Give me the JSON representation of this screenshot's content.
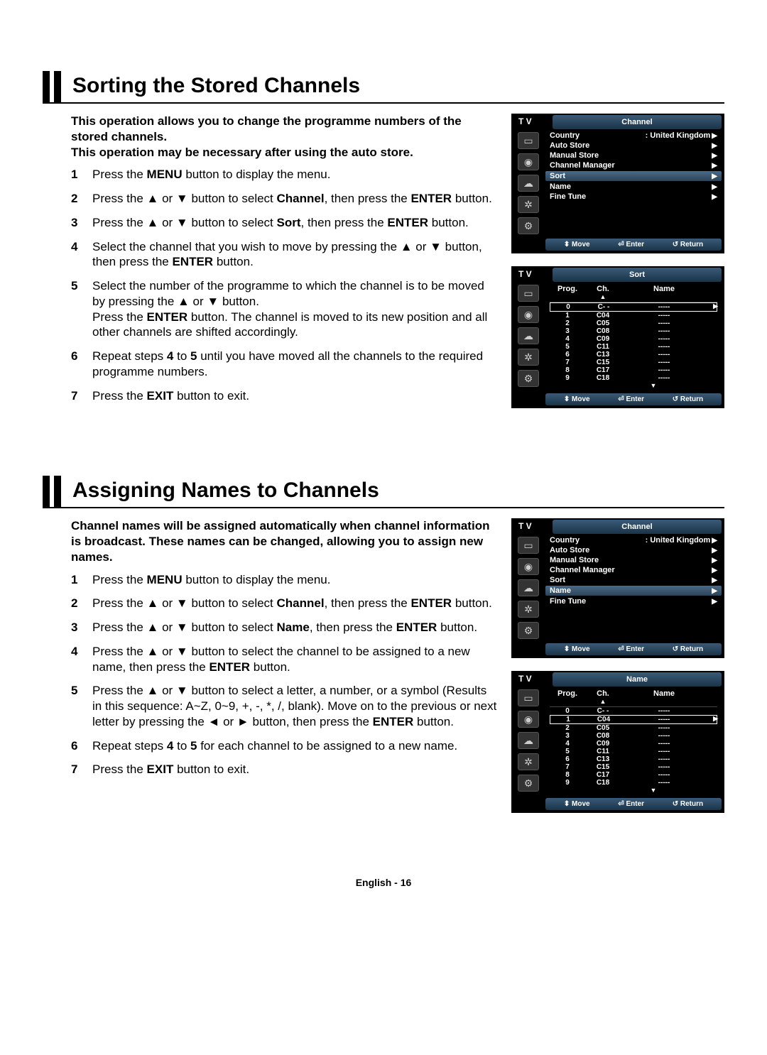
{
  "sections": [
    {
      "title": "Sorting the Stored Channels",
      "intro": "This operation allows you to change the programme numbers of the stored channels.\nThis operation may be necessary after using the auto store.",
      "steps": [
        {
          "n": "1",
          "html": "Press the <b>MENU</b> button to display the menu."
        },
        {
          "n": "2",
          "html": "Press the ▲ or ▼ button to select <b>Channel</b>, then press the <b>ENTER</b> button."
        },
        {
          "n": "3",
          "html": "Press the ▲ or ▼ button to select <b>Sort</b>, then press the <b>ENTER</b> button."
        },
        {
          "n": "4",
          "html": "Select the channel that you wish to move by pressing the ▲ or ▼ button, then press the <b>ENTER</b> button."
        },
        {
          "n": "5",
          "html": "Select the number of the programme to which the channel is to be moved by pressing the ▲ or ▼ button.<br>Press the <b>ENTER</b> button. The channel is moved to its new position and all other channels are shifted accordingly."
        },
        {
          "n": "6",
          "html": "Repeat steps <b>4</b> to <b>5</b> until you have moved all the channels to the required programme numbers."
        },
        {
          "n": "7",
          "html": "Press the <b>EXIT</b> button to exit."
        }
      ],
      "screens": [
        {
          "type": "menu",
          "title": "Channel",
          "highlight": "Sort",
          "items": [
            {
              "label": "Country",
              "value": ": United Kingdom",
              "arrow": true
            },
            {
              "label": "Auto Store",
              "value": "",
              "arrow": true
            },
            {
              "label": "Manual Store",
              "value": "",
              "arrow": true
            },
            {
              "label": "Channel Manager",
              "value": "",
              "arrow": true
            },
            {
              "label": "Sort",
              "value": "",
              "arrow": true,
              "hl": true
            },
            {
              "label": "Name",
              "value": "",
              "arrow": true
            },
            {
              "label": "Fine Tune",
              "value": "",
              "arrow": true
            }
          ]
        },
        {
          "type": "table",
          "title": "Sort",
          "highlightRow": 0,
          "rows": [
            {
              "prog": "0",
              "ch": "C- -",
              "name": "-----"
            },
            {
              "prog": "1",
              "ch": "C04",
              "name": "-----"
            },
            {
              "prog": "2",
              "ch": "C05",
              "name": "-----"
            },
            {
              "prog": "3",
              "ch": "C08",
              "name": "-----"
            },
            {
              "prog": "4",
              "ch": "C09",
              "name": "-----"
            },
            {
              "prog": "5",
              "ch": "C11",
              "name": "-----"
            },
            {
              "prog": "6",
              "ch": "C13",
              "name": "-----"
            },
            {
              "prog": "7",
              "ch": "C15",
              "name": "-----"
            },
            {
              "prog": "8",
              "ch": "C17",
              "name": "-----"
            },
            {
              "prog": "9",
              "ch": "C18",
              "name": "-----"
            }
          ]
        }
      ]
    },
    {
      "title": "Assigning Names to Channels",
      "intro": "Channel names will be assigned automatically when channel information is broadcast. These names can be changed, allowing you to assign new names.",
      "steps": [
        {
          "n": "1",
          "html": "Press the <b>MENU</b> button to display the menu."
        },
        {
          "n": "2",
          "html": "Press the ▲ or ▼ button to select <b>Channel</b>, then press the <b>ENTER</b> button."
        },
        {
          "n": "3",
          "html": "Press the ▲ or ▼ button to select <b>Name</b>, then press the <b>ENTER</b> button."
        },
        {
          "n": "4",
          "html": "Press the ▲ or ▼ button to select the channel to be assigned to a new name, then press the <b>ENTER</b> button."
        },
        {
          "n": "5",
          "html": "Press the ▲ or ▼ button to select a letter, a number, or a symbol (Results in this sequence: A~Z, 0~9, +, -, *, /, blank). Move on to the previous or next letter by pressing the ◄ or ► button, then press the <b>ENTER</b> button."
        },
        {
          "n": "6",
          "html": "Repeat steps <b>4</b> to <b>5</b> for each channel to be assigned to a new name."
        },
        {
          "n": "7",
          "html": "Press the <b>EXIT</b> button to exit."
        }
      ],
      "screens": [
        {
          "type": "menu",
          "title": "Channel",
          "highlight": "Name",
          "items": [
            {
              "label": "Country",
              "value": ": United Kingdom",
              "arrow": true
            },
            {
              "label": "Auto Store",
              "value": "",
              "arrow": true
            },
            {
              "label": "Manual Store",
              "value": "",
              "arrow": true
            },
            {
              "label": "Channel Manager",
              "value": "",
              "arrow": true
            },
            {
              "label": "Sort",
              "value": "",
              "arrow": true
            },
            {
              "label": "Name",
              "value": "",
              "arrow": true,
              "hl": true
            },
            {
              "label": "Fine Tune",
              "value": "",
              "arrow": true
            }
          ]
        },
        {
          "type": "table",
          "title": "Name",
          "highlightRow": 1,
          "rows": [
            {
              "prog": "0",
              "ch": "C- -",
              "name": "-----"
            },
            {
              "prog": "1",
              "ch": "C04",
              "name": "-----"
            },
            {
              "prog": "2",
              "ch": "C05",
              "name": "-----"
            },
            {
              "prog": "3",
              "ch": "C08",
              "name": "-----"
            },
            {
              "prog": "4",
              "ch": "C09",
              "name": "-----"
            },
            {
              "prog": "5",
              "ch": "C11",
              "name": "-----"
            },
            {
              "prog": "6",
              "ch": "C13",
              "name": "-----"
            },
            {
              "prog": "7",
              "ch": "C15",
              "name": "-----"
            },
            {
              "prog": "8",
              "ch": "C17",
              "name": "-----"
            },
            {
              "prog": "9",
              "ch": "C18",
              "name": "-----"
            }
          ]
        }
      ]
    }
  ],
  "osd": {
    "tv_label": "T V",
    "footer": {
      "move": "Move",
      "enter": "Enter",
      "return": "Return"
    },
    "table_headers": {
      "prog": "Prog.",
      "ch": "Ch.",
      "name": "Name"
    },
    "icons": [
      "▭",
      "◉",
      "☁",
      "✲",
      "⚙"
    ]
  },
  "page_footer": "English - 16"
}
